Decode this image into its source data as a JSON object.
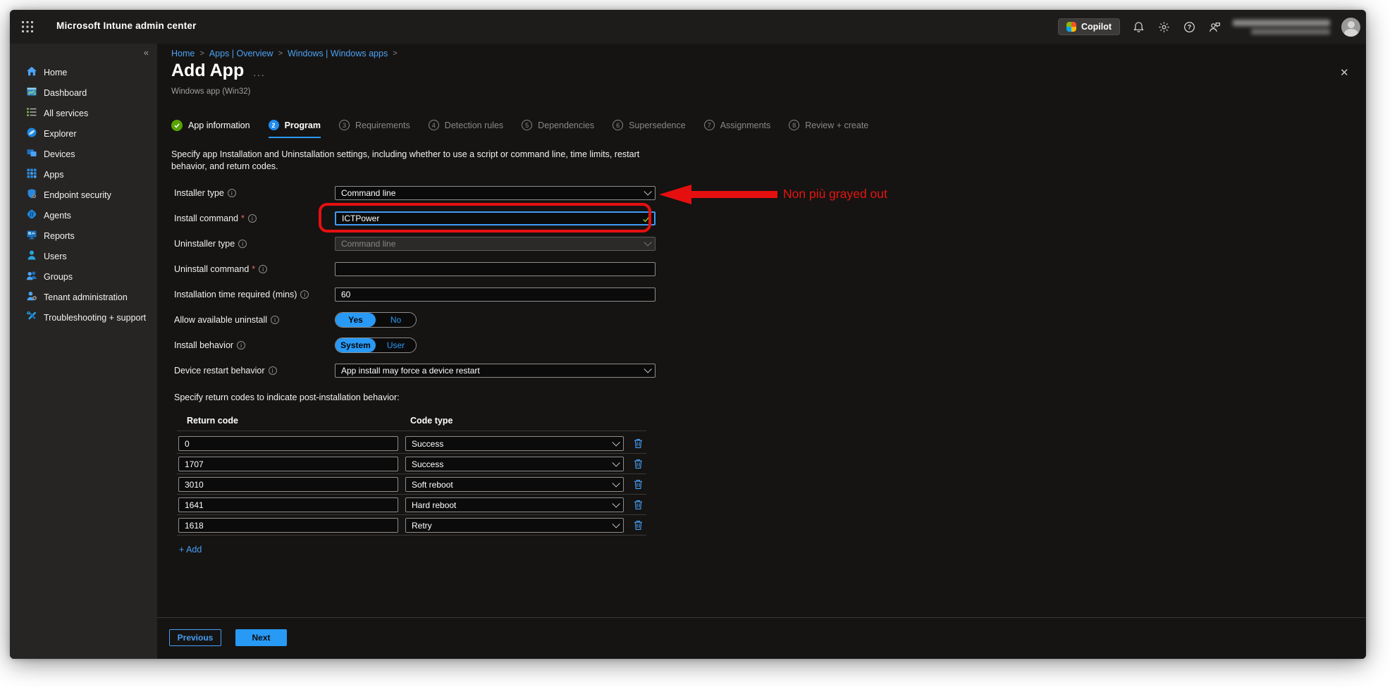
{
  "topbar": {
    "title": "Microsoft Intune admin center",
    "copilot_label": "Copilot"
  },
  "icons": {
    "collapse": "«",
    "close": "✕",
    "more": "···",
    "help": "?",
    "info": "i",
    "separator": ">",
    "required_mark": "*"
  },
  "sidebar": {
    "items": [
      {
        "label": "Home",
        "icon": "home-icon"
      },
      {
        "label": "Dashboard",
        "icon": "dashboard-icon"
      },
      {
        "label": "All services",
        "icon": "all-services-icon"
      },
      {
        "label": "Explorer",
        "icon": "explorer-icon"
      },
      {
        "label": "Devices",
        "icon": "devices-icon"
      },
      {
        "label": "Apps",
        "icon": "apps-icon"
      },
      {
        "label": "Endpoint security",
        "icon": "endpoint-security-icon"
      },
      {
        "label": "Agents",
        "icon": "agents-icon"
      },
      {
        "label": "Reports",
        "icon": "reports-icon"
      },
      {
        "label": "Users",
        "icon": "users-icon"
      },
      {
        "label": "Groups",
        "icon": "groups-icon"
      },
      {
        "label": "Tenant administration",
        "icon": "tenant-administration-icon"
      },
      {
        "label": "Troubleshooting + support",
        "icon": "troubleshooting-icon"
      }
    ]
  },
  "breadcrumb": {
    "items": [
      "Home",
      "Apps | Overview",
      "Windows | Windows apps"
    ]
  },
  "page": {
    "title": "Add App",
    "subtitle": "Windows app (Win32)"
  },
  "wizard": {
    "steps": [
      {
        "label": "App information",
        "state": "done"
      },
      {
        "label": "Program",
        "number": "2",
        "state": "active"
      },
      {
        "label": "Requirements",
        "number": "3",
        "state": "todo"
      },
      {
        "label": "Detection rules",
        "number": "4",
        "state": "todo"
      },
      {
        "label": "Dependencies",
        "number": "5",
        "state": "todo"
      },
      {
        "label": "Supersedence",
        "number": "6",
        "state": "todo"
      },
      {
        "label": "Assignments",
        "number": "7",
        "state": "todo"
      },
      {
        "label": "Review + create",
        "number": "8",
        "state": "todo"
      }
    ],
    "description": "Specify app Installation and Uninstallation settings, including whether to use a script or command line, time limits, restart behavior, and return codes."
  },
  "form": {
    "installer_type": {
      "label": "Installer type",
      "value": "Command line"
    },
    "install_command": {
      "label": "Install command",
      "value": "ICTPower"
    },
    "uninstaller_type": {
      "label": "Uninstaller type",
      "value": "Command line"
    },
    "uninstall_command": {
      "label": "Uninstall command",
      "value": ""
    },
    "install_time": {
      "label": "Installation time required (mins)",
      "value": "60"
    },
    "allow_uninstall": {
      "label": "Allow available uninstall",
      "options": [
        "Yes",
        "No"
      ],
      "selected": "Yes"
    },
    "install_behavior": {
      "label": "Install behavior",
      "options": [
        "System",
        "User"
      ],
      "selected": "System"
    },
    "restart_behavior": {
      "label": "Device restart behavior",
      "value": "App install may force a device restart"
    },
    "return_codes_caption": "Specify return codes to indicate post-installation behavior:",
    "return_codes": {
      "headers": [
        "Return code",
        "Code type"
      ],
      "rows": [
        {
          "code": "0",
          "type": "Success"
        },
        {
          "code": "1707",
          "type": "Success"
        },
        {
          "code": "3010",
          "type": "Soft reboot"
        },
        {
          "code": "1641",
          "type": "Hard reboot"
        },
        {
          "code": "1618",
          "type": "Retry"
        }
      ]
    },
    "add_label": "+ Add"
  },
  "footer": {
    "previous_label": "Previous",
    "next_label": "Next"
  },
  "annotation": {
    "text": "Non più grayed out",
    "color": "#e8150f"
  },
  "colors": {
    "accent_blue": "#2899f5",
    "link_blue": "#4da2f2",
    "done_green": "#57a300",
    "valid_green": "#86bc25",
    "annotation_red": "#e60f0f",
    "topbar_bg": "#1d1c1b",
    "sidebar_bg": "#262524",
    "content_bg": "#151413"
  }
}
